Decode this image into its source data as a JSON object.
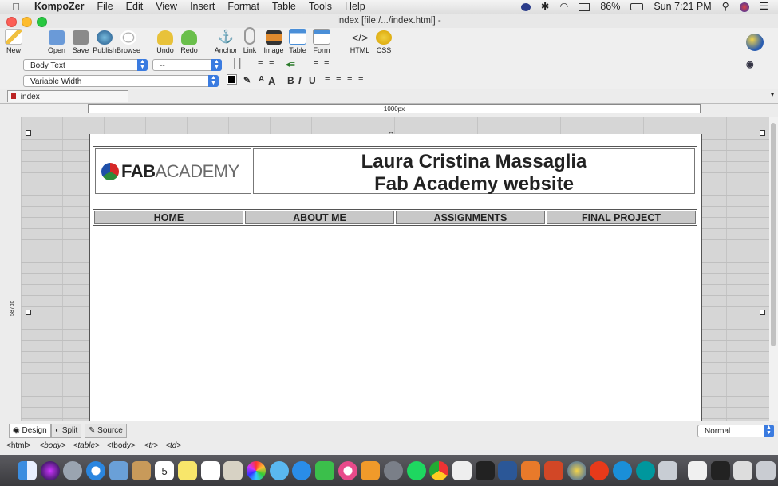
{
  "menubar": {
    "app": "KompoZer",
    "items": [
      "File",
      "Edit",
      "View",
      "Insert",
      "Format",
      "Table",
      "Tools",
      "Help"
    ],
    "battery": "86%",
    "clock": "Sun 7:21 PM"
  },
  "window": {
    "title": "index [file:/.../index.html] -"
  },
  "toolbar": {
    "buttons": [
      "New",
      "Open",
      "Save",
      "Publish",
      "Browse",
      "Undo",
      "Redo",
      "Anchor",
      "Link",
      "Image",
      "Table",
      "Form",
      "HTML",
      "CSS"
    ]
  },
  "format": {
    "paragraph_style": "Body Text",
    "font": "--",
    "width": "Variable Width"
  },
  "tabs": {
    "doc_tab": "index"
  },
  "ruler": {
    "width_label": "1000px",
    "height_label": "587px"
  },
  "page": {
    "logo_bold": "FAB",
    "logo_light": "ACADEMY",
    "title_line1": "Laura Cristina Massaglia",
    "title_line2": "Fab Academy website",
    "nav": [
      "HOME",
      "ABOUT ME",
      "ASSIGNMENTS",
      "FINAL PROJECT"
    ]
  },
  "viewtabs": [
    "Design",
    "Split",
    "Source"
  ],
  "mode_select": "Normal",
  "statusbar": [
    "<html>",
    "<body>",
    "<table>",
    "<tbody>",
    "<tr>",
    "<td>"
  ],
  "dock": {
    "calendar_day": "5"
  },
  "colors": {
    "accent": "#3a7be0",
    "nav_bg": "#c8c8c8"
  }
}
